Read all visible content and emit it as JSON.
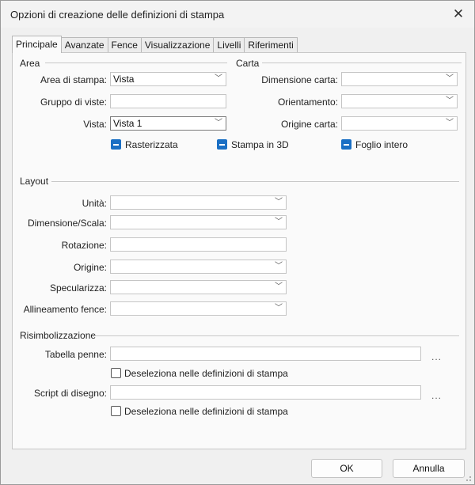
{
  "window": {
    "title": "Opzioni di creazione delle definizioni di stampa"
  },
  "tabs": [
    {
      "label": "Principale",
      "active": true
    },
    {
      "label": "Avanzate"
    },
    {
      "label": "Fence"
    },
    {
      "label": "Visualizzazione"
    },
    {
      "label": "Livelli"
    },
    {
      "label": "Riferimenti"
    }
  ],
  "area": {
    "title": "Area",
    "area_di_stampa": {
      "label": "Area di stampa:",
      "value": "Vista"
    },
    "gruppo_di_viste": {
      "label": "Gruppo di viste:",
      "value": ""
    },
    "vista": {
      "label": "Vista:",
      "value": "Vista 1"
    },
    "rasterizzata": {
      "label": "Rasterizzata",
      "checked": true
    },
    "stampa_3d": {
      "label": "Stampa in 3D",
      "checked": true
    }
  },
  "carta": {
    "title": "Carta",
    "dimensione_carta": {
      "label": "Dimensione carta:",
      "value": ""
    },
    "orientamento": {
      "label": "Orientamento:",
      "value": ""
    },
    "origine_carta": {
      "label": "Origine carta:",
      "value": ""
    },
    "foglio_intero": {
      "label": "Foglio intero",
      "checked": true
    }
  },
  "layout": {
    "title": "Layout",
    "unita": {
      "label": "Unità:",
      "value": ""
    },
    "dimensione_scala": {
      "label": "Dimensione/Scala:",
      "value": ""
    },
    "rotazione": {
      "label": "Rotazione:",
      "value": ""
    },
    "origine": {
      "label": "Origine:",
      "value": ""
    },
    "specularizza": {
      "label": "Specularizza:",
      "value": ""
    },
    "allineamento_fence": {
      "label": "Allineamento fence:",
      "value": ""
    }
  },
  "risimbolizzazione": {
    "title": "Risimbolizzazione",
    "tabella_penne": {
      "label": "Tabella penne:",
      "value": "",
      "browse": "..."
    },
    "deseleziona_1": {
      "label": "Deseleziona nelle definizioni di stampa",
      "checked": false
    },
    "script_di_disegno": {
      "label": "Script di disegno:",
      "value": "",
      "browse": "..."
    },
    "deseleziona_2": {
      "label": "Deseleziona nelle definizioni di stampa",
      "checked": false
    }
  },
  "footer": {
    "ok": "OK",
    "cancel": "Annulla"
  },
  "colors": {
    "accent": "#1a6fc4",
    "panel": "#fafafa",
    "chrome": "#f0f0f0"
  }
}
